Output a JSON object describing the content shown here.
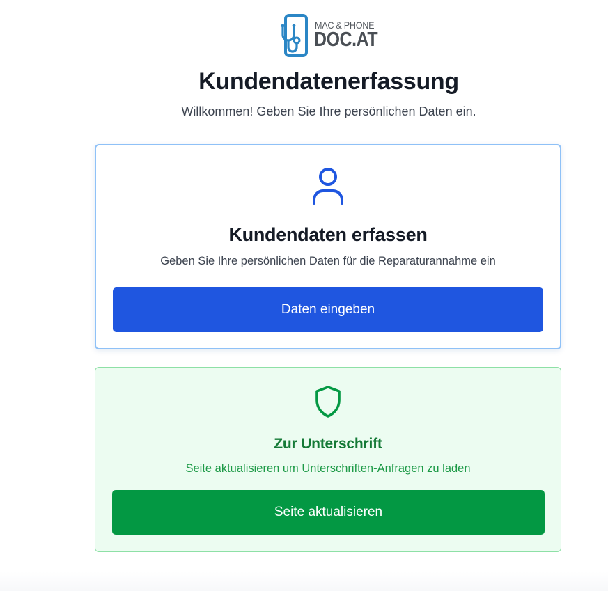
{
  "brand": {
    "logo_line1": "MAC & PHONE",
    "logo_line2": "DOC.AT",
    "logo_color": "#2b86c5"
  },
  "header": {
    "title": "Kundendatenerfassung",
    "subtitle": "Willkommen! Geben Sie Ihre persönlichen Daten ein."
  },
  "customer_card": {
    "icon": "user-icon",
    "title": "Kundendaten erfassen",
    "description": "Geben Sie Ihre persönlichen Daten für die Reparaturannahme ein",
    "button_label": "Daten eingeben",
    "accent_color": "#1f56e0"
  },
  "signature_card": {
    "icon": "shield-icon",
    "title": "Zur Unterschrift",
    "description": "Seite aktualisieren um Unterschriften-Anfragen zu laden",
    "button_label": "Seite aktualisieren",
    "accent_color": "#039843"
  }
}
